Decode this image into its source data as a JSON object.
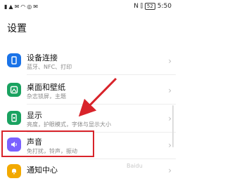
{
  "status": {
    "left_icons": [
      "sim-icon",
      "signal-icon",
      "message-icon",
      "wifi-icon",
      "chat-icon",
      "mail-icon"
    ],
    "battery": "52",
    "time": "5:50"
  },
  "page": {
    "title": "设置"
  },
  "items": [
    {
      "title": "设备连接",
      "subtitle": "蓝牙、NFC、打印",
      "icon": "device-connection-icon",
      "color": "#1a73e8"
    },
    {
      "title": "桌面和壁纸",
      "subtitle": "杂志锁屏，主题",
      "icon": "wallpaper-icon",
      "color": "#1aa260"
    },
    {
      "title": "显示",
      "subtitle": "亮度，护眼模式，字体与显示大小",
      "icon": "display-icon",
      "color": "#1aa260"
    },
    {
      "title": "声音",
      "subtitle": "免打扰，铃声，振动",
      "icon": "sound-icon",
      "color": "#7b61ff"
    },
    {
      "title": "通知中心",
      "subtitle": "",
      "icon": "notification-icon",
      "color": "#f2a900"
    }
  ],
  "annotation": {
    "highlight_color": "#d8232a"
  },
  "watermark": "Baidu"
}
